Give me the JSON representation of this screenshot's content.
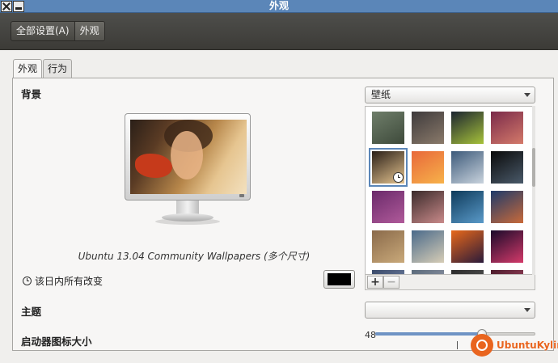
{
  "window": {
    "title": "外观"
  },
  "toolbar": {
    "breadcrumbs": [
      "全部设置(A)",
      "外观"
    ]
  },
  "tabs": [
    "外观",
    "行为"
  ],
  "background": {
    "label": "背景",
    "wallpaper_name": "Ubuntu 13.04 Community Wallpapers (多个尺寸)",
    "source_combo": "壁纸",
    "apply_scope": "该日内所有改变",
    "color": "#000000",
    "wallpapers": [
      {
        "colors": [
          "#6f7e6a",
          "#3e4a3b"
        ]
      },
      {
        "colors": [
          "#3e3a3c",
          "#8a7a6a"
        ]
      },
      {
        "colors": [
          "#1b2430",
          "#a7c23a"
        ]
      },
      {
        "colors": [
          "#7a2a4a",
          "#d47a6a"
        ]
      },
      {
        "colors": [
          "#2a1f18",
          "#e6c590"
        ],
        "selected": true
      },
      {
        "colors": [
          "#e8683a",
          "#f7b24a"
        ]
      },
      {
        "colors": [
          "#3d5a7a",
          "#c9d3dd"
        ]
      },
      {
        "colors": [
          "#0a0a0a",
          "#4a5a6a"
        ]
      },
      {
        "colors": [
          "#6a2a6a",
          "#b05a9a"
        ]
      },
      {
        "colors": [
          "#3a2a2a",
          "#c98a8a"
        ]
      },
      {
        "colors": [
          "#0e3a5a",
          "#5a9ac9"
        ]
      },
      {
        "colors": [
          "#1e3a6a",
          "#c96a3a"
        ]
      },
      {
        "colors": [
          "#8a6a4a",
          "#c9a97a"
        ]
      },
      {
        "colors": [
          "#4a6a8a",
          "#d7cdb6"
        ]
      },
      {
        "colors": [
          "#e8681a",
          "#2a1a3a"
        ]
      },
      {
        "colors": [
          "#1a0a2a",
          "#d43a6a"
        ]
      },
      {
        "colors": [
          "#3a4a6a",
          "#8a9aba"
        ]
      },
      {
        "colors": [
          "#5a6a7a",
          "#aab"
        ]
      },
      {
        "colors": [
          "#2a2a2a",
          "#6a6a6a"
        ]
      },
      {
        "colors": [
          "#4a1a2a",
          "#c95a7a"
        ]
      }
    ]
  },
  "theme": {
    "label": "主题",
    "value": ""
  },
  "launcher": {
    "label": "启动器图标大小",
    "icon_size": 48,
    "min": 16,
    "max": 64
  },
  "logo": {
    "text": "UbuntuKylin"
  },
  "colors": {
    "titlebar": "#5b86b8",
    "accent": "#e9651f"
  }
}
